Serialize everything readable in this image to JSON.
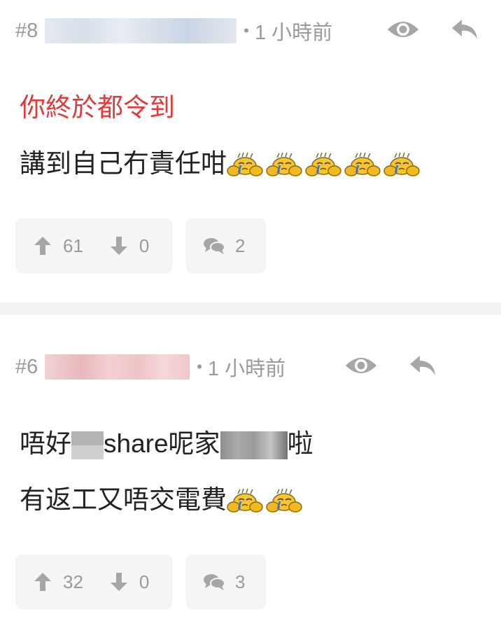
{
  "posts": [
    {
      "floor": "#8",
      "time": "1 小時前",
      "lines": [
        "你終於都令到",
        "講到自己冇責任咁"
      ],
      "emoji_count": 5,
      "upvotes": "61",
      "downvotes": "0",
      "comments": "2"
    },
    {
      "floor": "#6",
      "time": "1 小時前",
      "line1_a": "唔好",
      "line1_b": "share呢家",
      "line1_c": "啦",
      "line2": "有返工又唔交電費",
      "emoji_count": 2,
      "upvotes": "32",
      "downvotes": "0",
      "comments": "3"
    }
  ],
  "icons": {
    "view": "eye-icon",
    "reply": "reply-arrow-icon",
    "up": "arrow-up-icon",
    "down": "arrow-down-icon",
    "comment": "comment-bubbles-icon",
    "emoji": "crying-face-emoticon"
  },
  "colors": {
    "meta_text": "#9a9a9a",
    "highlight_text": "#e03b3b",
    "body_text": "#222222",
    "card_bg": "#f5f5f5"
  }
}
